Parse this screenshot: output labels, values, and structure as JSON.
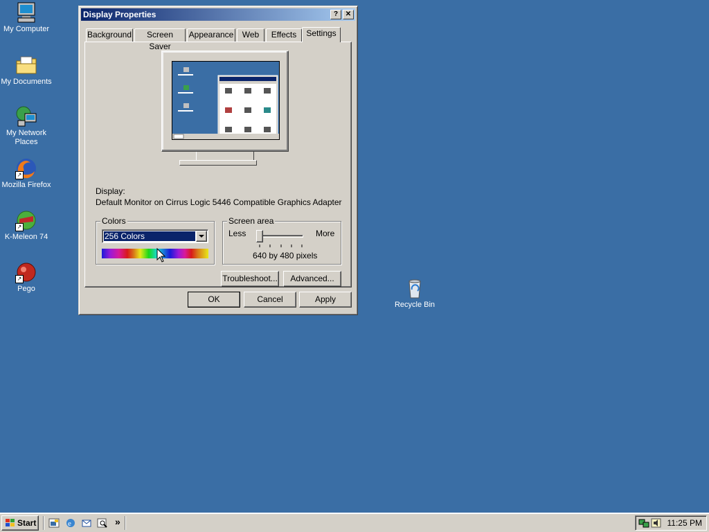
{
  "desktop": {
    "icons": [
      {
        "label": "My Computer"
      },
      {
        "label": "My Documents"
      },
      {
        "label": "My Network Places"
      },
      {
        "label": "Mozilla Firefox"
      },
      {
        "label": "K-Meleon 74"
      },
      {
        "label": "Pego"
      },
      {
        "label": "Recycle Bin"
      }
    ],
    "background_color": "#3a6ea5"
  },
  "window": {
    "title": "Display Properties",
    "help_button": "?",
    "close_button": "✕",
    "tabs": [
      {
        "label": "Background"
      },
      {
        "label": "Screen Saver"
      },
      {
        "label": "Appearance"
      },
      {
        "label": "Web"
      },
      {
        "label": "Effects"
      },
      {
        "label": "Settings",
        "active": true
      }
    ],
    "display_label": "Display:",
    "display_value": "Default Monitor on Cirrus Logic 5446 Compatible Graphics Adapter",
    "colors": {
      "group_label": "Colors",
      "selected": "256 Colors"
    },
    "screen_area": {
      "group_label": "Screen area",
      "less": "Less",
      "more": "More",
      "value_text": "640 by 480 pixels",
      "slider_position": 0
    },
    "buttons": {
      "troubleshoot": "Troubleshoot...",
      "advanced": "Advanced...",
      "ok": "OK",
      "cancel": "Cancel",
      "apply": "Apply"
    }
  },
  "taskbar": {
    "start_label": "Start",
    "chevron": "»",
    "clock": "11:25 PM"
  },
  "colors": {
    "titlebar_start": "#0a246a",
    "titlebar_end": "#a6caf0",
    "face": "#d4d0c8",
    "selection": "#0a246a"
  }
}
